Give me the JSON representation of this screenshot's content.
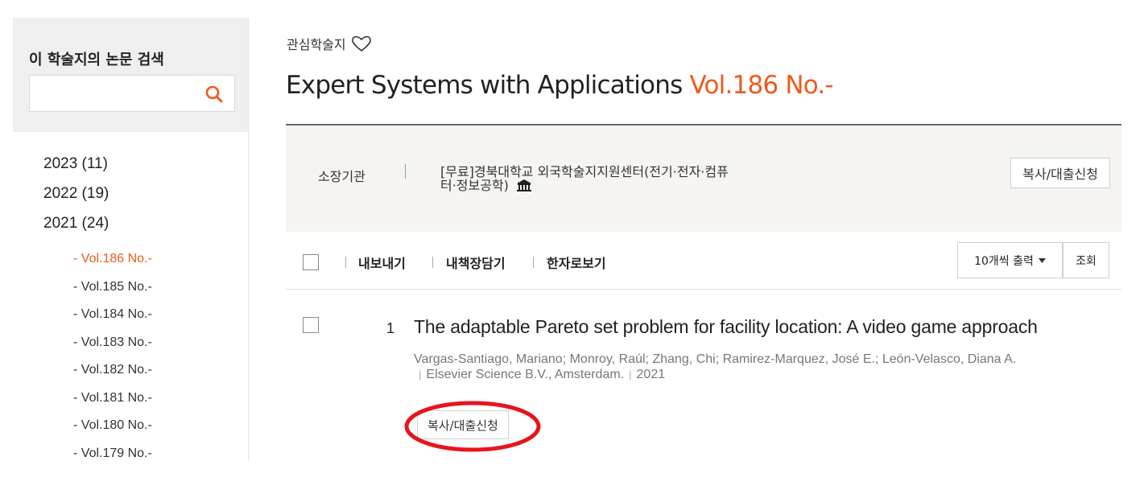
{
  "sidebar": {
    "search_title": "이 학술지의 논문 검색",
    "search_value": "",
    "years": [
      "2023 (11)",
      "2022 (19)",
      "2021 (24)"
    ],
    "volumes": [
      {
        "label": "- Vol.186 No.-",
        "active": true
      },
      {
        "label": "- Vol.185 No.-",
        "active": false
      },
      {
        "label": "- Vol.184 No.-",
        "active": false
      },
      {
        "label": "- Vol.183 No.-",
        "active": false
      },
      {
        "label": "- Vol.182 No.-",
        "active": false
      },
      {
        "label": "- Vol.181 No.-",
        "active": false
      },
      {
        "label": "- Vol.180 No.-",
        "active": false
      },
      {
        "label": "- Vol.179 No.-",
        "active": false
      }
    ]
  },
  "header": {
    "favorite_label": "관심학술지",
    "journal_name": "Expert Systems with Applications",
    "journal_volume": "Vol.186 No.-"
  },
  "holding": {
    "label": "소장기관",
    "institution": "[무료]경북대학교 외국학술지지원센터(전기·전자·컴퓨터·정보공학)",
    "copy_button": "복사/대출신청"
  },
  "toolbar": {
    "export": "내보내기",
    "add_to_shelf": "내책장담기",
    "hanja_view": "한자로보기",
    "per_page": "10개씩 출력",
    "query_button": "조회"
  },
  "result": {
    "number": "1",
    "title": "The adaptable Pareto set problem for facility location: A video game approach",
    "authors": "Vargas-Santiago, Mariano; Monroy, Raúl; Zhang, Chi; Ramirez-Marquez, José E.; León-Velasco, Diana A.",
    "publisher": "Elsevier Science B.V., Amsterdam.",
    "year": "2021",
    "copy_button": "복사/대출신청"
  },
  "colors": {
    "accent": "#ee5a1c",
    "annotation": "#e8141c"
  }
}
